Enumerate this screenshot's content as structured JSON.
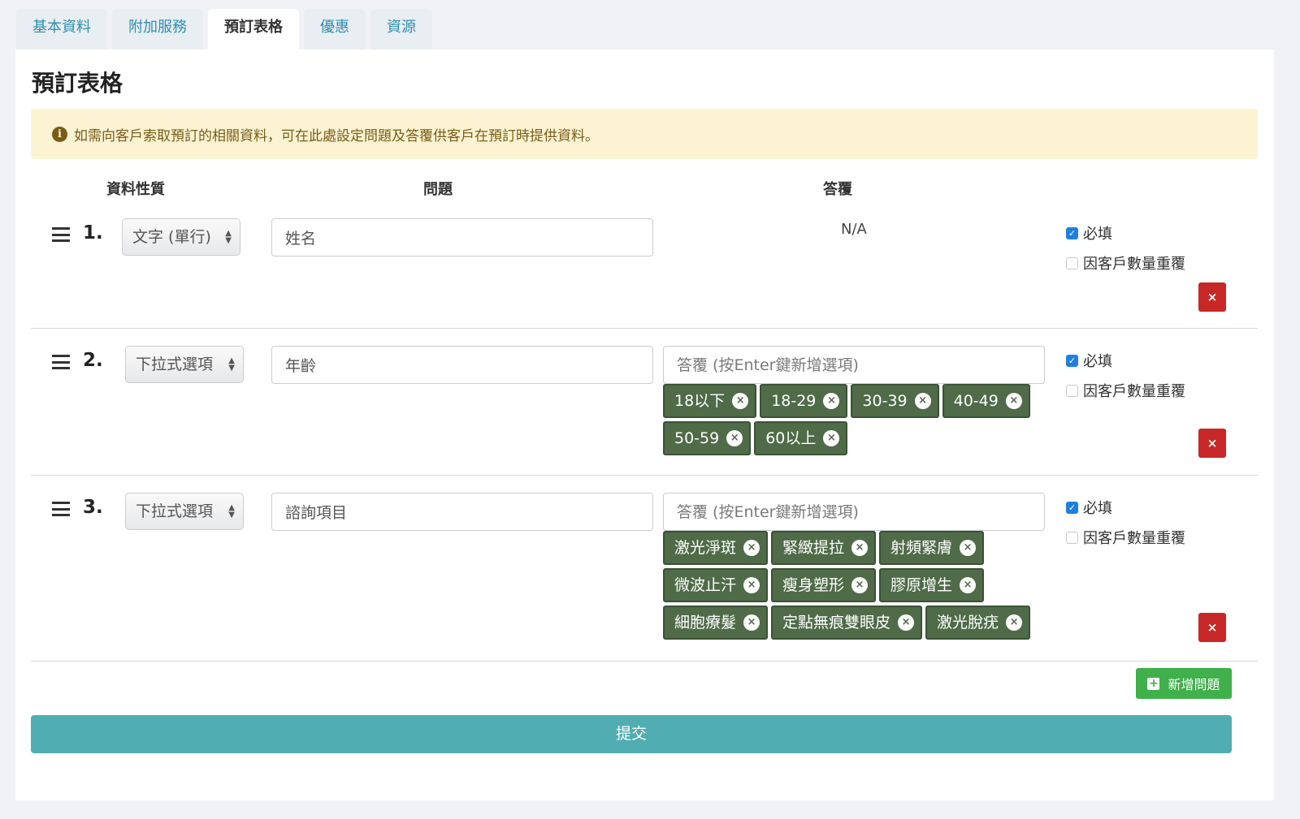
{
  "tabs": [
    {
      "label": "基本資料"
    },
    {
      "label": "附加服務"
    },
    {
      "label": "預訂表格"
    },
    {
      "label": "優惠"
    },
    {
      "label": "資源"
    }
  ],
  "section_title": "預訂表格",
  "alert": {
    "text": "如需向客戶索取預訂的相關資料，可在此處設定問題及答覆供客戶在預訂時提供資料。",
    "icon": "info-icon"
  },
  "columns": {
    "type": "資料性質",
    "question": "問題",
    "answer": "答覆"
  },
  "rows": [
    {
      "number": "1.",
      "type": "文字 (單行)",
      "question": "姓名",
      "answer_na": "N/A",
      "required_label": "必填",
      "required": true,
      "repeat_label": "因客戶數量重覆",
      "repeat": false
    },
    {
      "number": "2.",
      "type": "下拉式選項",
      "question": "年齡",
      "answer_placeholder": "答覆 (按Enter鍵新增選項)",
      "options": [
        "18以下",
        "18-29",
        "30-39",
        "40-49",
        "50-59",
        "60以上"
      ],
      "required_label": "必填",
      "required": true,
      "repeat_label": "因客戶數量重覆",
      "repeat": false
    },
    {
      "number": "3.",
      "type": "下拉式選項",
      "question": "諮詢項目",
      "answer_placeholder": "答覆 (按Enter鍵新增選項)",
      "options": [
        "激光淨斑",
        "緊緻提拉",
        "射頻緊膚",
        "微波止汗",
        "瘦身塑形",
        "膠原增生",
        "細胞療髮",
        "定點無痕雙眼皮",
        "激光脫疣"
      ],
      "required_label": "必填",
      "required": true,
      "repeat_label": "因客戶數量重覆",
      "repeat": false
    }
  ],
  "add_question_label": "新增問題",
  "submit_label": "提交",
  "delete_label": "×",
  "colors": {
    "tag": "#4f6b48",
    "delete": "#c62828",
    "add": "#3fb04a",
    "submit": "#50aeb3",
    "alert_bg": "#fcf3d3",
    "tab_link": "#2e8fb0"
  }
}
